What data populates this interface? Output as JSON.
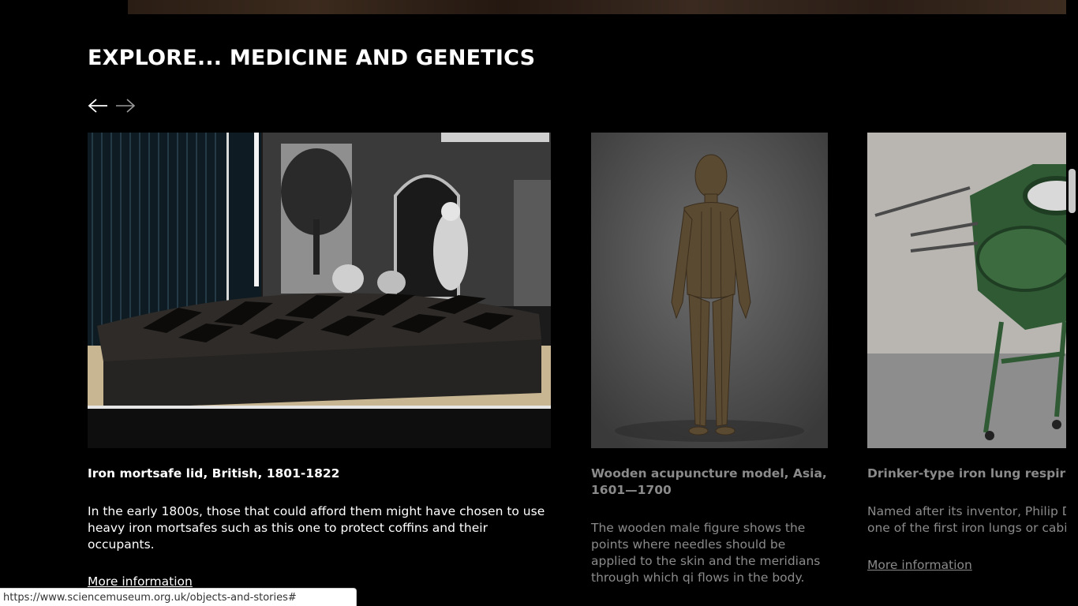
{
  "section": {
    "title": "EXPLORE... MEDICINE AND GENETICS"
  },
  "carousel": {
    "prev_icon": "arrow-left-icon",
    "next_icon": "arrow-right-icon"
  },
  "cards": [
    {
      "title": "Iron mortsafe lid, British, 1801-1822",
      "description": "In the early 1800s, those that could afford them might have chosen to use heavy iron mortsafes such as this one to protect coffins and their occupants.",
      "link": "More information"
    },
    {
      "title": "Wooden acupuncture model, Asia, 1601—1700",
      "description": "The wooden male figure shows the points where needles should be applied to the skin and the meridians through which qi flows in the body."
    },
    {
      "title": "Drinker-type iron lung respirator",
      "description": "Named after its inventor, Philip Drinker, one of the first iron lungs or cabinet respirators",
      "link": "More information"
    }
  ],
  "status_bar": {
    "url": "https://www.sciencemuseum.org.uk/objects-and-stories#"
  },
  "colors": {
    "background": "#000000",
    "text": "#ffffff",
    "dim_text": "#8a8a8a"
  }
}
